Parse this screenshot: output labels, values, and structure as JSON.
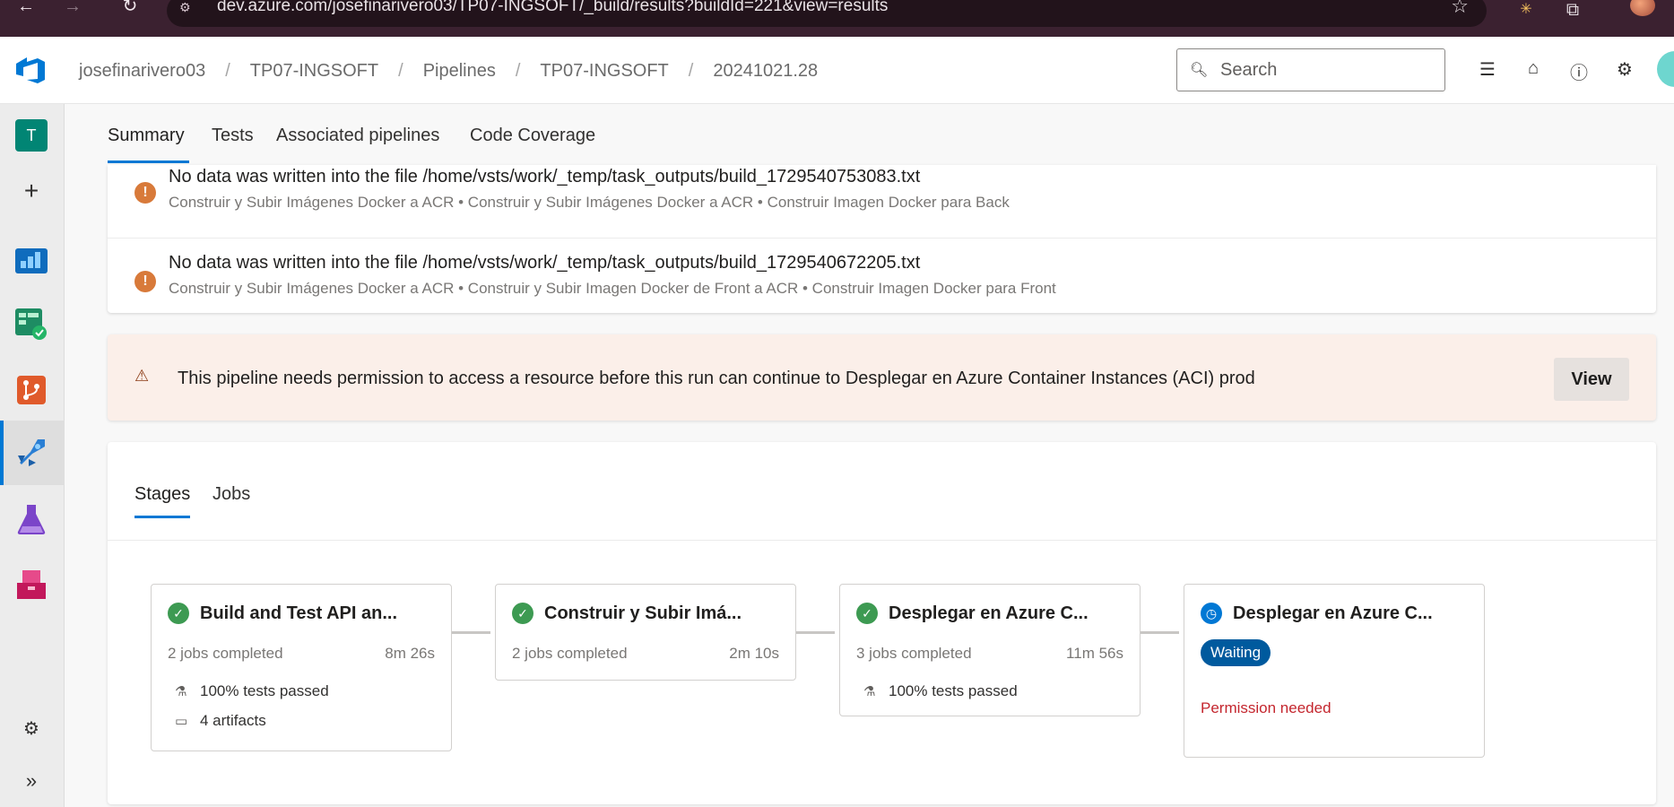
{
  "browser": {
    "url": "dev.azure.com/josefinarivero03/TP07-INGSOFT/_build/results?buildId=221&view=results"
  },
  "header": {
    "breadcrumbs": [
      "josefinarivero03",
      "TP07-INGSOFT",
      "Pipelines",
      "TP07-INGSOFT",
      "20241021.28"
    ],
    "breadcrumb_separator": "/",
    "search_placeholder": "Search"
  },
  "rail": {
    "project_initial": "T"
  },
  "tabs": {
    "items": [
      "Summary",
      "Tests",
      "Associated pipelines",
      "Code Coverage"
    ],
    "active": "Summary"
  },
  "warnings": [
    {
      "title": "No data was written into the file /home/vsts/work/_temp/task_outputs/build_1729540753083.txt",
      "path": "Construir y Subir Imágenes Docker a ACR • Construir y Subir Imágenes Docker a ACR • Construir Imagen Docker para Back"
    },
    {
      "title": "No data was written into the file /home/vsts/work/_temp/task_outputs/build_1729540672205.txt",
      "path": "Construir y Subir Imágenes Docker a ACR • Construir y Subir Imagen Docker de Front a ACR • Construir Imagen Docker para Front"
    }
  ],
  "banner": {
    "text": "This pipeline needs permission to access a resource before this run can continue to Desplegar en Azure Container Instances (ACI) prod",
    "button": "View"
  },
  "stages_section": {
    "tabs": [
      "Stages",
      "Jobs"
    ],
    "active_tab": "Stages",
    "stages": [
      {
        "name": "Build and Test API an...",
        "jobs": "2 jobs completed",
        "duration": "8m 26s",
        "tests": "100% tests passed",
        "artifacts": "4 artifacts",
        "status": "succeeded"
      },
      {
        "name": "Construir y Subir Imá...",
        "jobs": "2 jobs completed",
        "duration": "2m 10s",
        "status": "succeeded"
      },
      {
        "name": "Desplegar en Azure C...",
        "jobs": "3 jobs completed",
        "duration": "11m 56s",
        "tests": "100% tests passed",
        "status": "succeeded"
      },
      {
        "name": "Desplegar en Azure C...",
        "badge": "Waiting",
        "note": "Permission needed",
        "status": "waiting"
      }
    ]
  },
  "colors": {
    "accent": "#0078d4",
    "success": "#3d9a52",
    "warning": "#d87a3a",
    "error": "#c4262e",
    "banner_bg": "#fbefe9"
  }
}
